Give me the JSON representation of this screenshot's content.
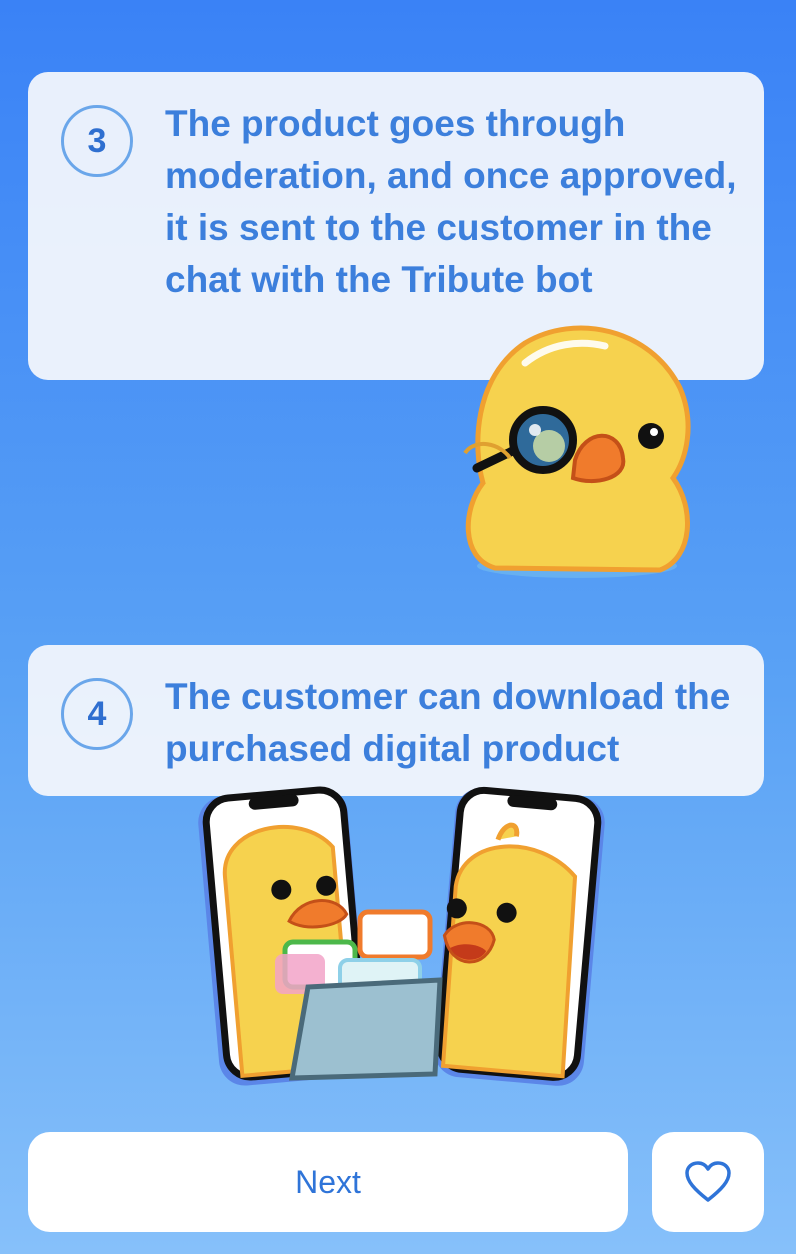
{
  "steps": [
    {
      "number": "3",
      "text": "The product goes through moderation, and once approved, it is sent to the customer in the chat with the Tribute bot"
    },
    {
      "number": "4",
      "text": "The customer can download the purchased digital product"
    }
  ],
  "footer": {
    "next_label": "Next",
    "favorite_icon": "heart-icon"
  },
  "colors": {
    "accent": "#3c7fdc",
    "duck_yellow": "#f6d24e",
    "beak_orange": "#f07b2c"
  }
}
